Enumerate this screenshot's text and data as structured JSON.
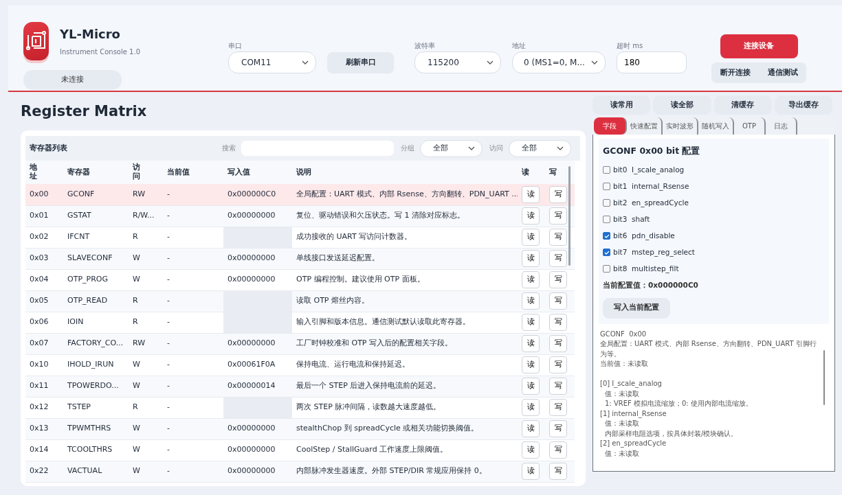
{
  "app": {
    "name": "YL-Micro",
    "subtitle": "Instrument Console 1.0",
    "status": "未连接"
  },
  "connection": {
    "port": {
      "label": "串口",
      "value": "COM11"
    },
    "refresh": "刷新串口",
    "baud": {
      "label": "波特率",
      "value": "115200"
    },
    "address": {
      "label": "地址",
      "value": "0 (MS1=0, M..."
    },
    "timeout": {
      "label": "超时 ms",
      "value": "180"
    },
    "connect": "连接设备",
    "disconnect": "断开连接",
    "test": "通信测试"
  },
  "title": "Register Matrix",
  "actions": [
    "读常用",
    "读全部",
    "清缓存",
    "导出缓存"
  ],
  "register_list": {
    "title": "寄存器列表",
    "search_label": "搜索",
    "group_label": "分组",
    "group_value": "全部",
    "access_label": "访问",
    "access_value": "全部",
    "columns": [
      "地址",
      "寄存器",
      "访问",
      "当前值",
      "写入值",
      "说明",
      "读",
      "写"
    ],
    "rows": [
      {
        "addr": "0x00",
        "name": "GCONF",
        "access": "RW",
        "current": "-",
        "write": "0x000000C0",
        "desc": "全局配置：UART 模式、内部 Rsense、方向翻转、PDN_UART ...",
        "read_button": "读",
        "write_button": "写",
        "selected": true
      },
      {
        "addr": "0x01",
        "name": "GSTAT",
        "access": "R/W...",
        "current": "-",
        "write": "0x00000000",
        "desc": "复位、驱动错误和欠压状态。写 1 清除对应标志。",
        "read_button": "读",
        "write_button": "写",
        "selected": false
      },
      {
        "addr": "0x02",
        "name": "IFCNT",
        "access": "R",
        "current": "-",
        "desc": "成功接收的 UART 写访问计数器。",
        "read_button": "读",
        "write_button": "写",
        "selected": false
      },
      {
        "addr": "0x03",
        "name": "SLAVECONF",
        "access": "W",
        "current": "-",
        "write": "0x00000000",
        "desc": "单线接口发送延迟配置。",
        "read_button": "读",
        "write_button": "写",
        "selected": false
      },
      {
        "addr": "0x04",
        "name": "OTP_PROG",
        "access": "W",
        "current": "-",
        "write": "0x00000000",
        "desc": "OTP 编程控制。建议使用 OTP 面板。",
        "read_button": "读",
        "write_button": "写",
        "selected": false
      },
      {
        "addr": "0x05",
        "name": "OTP_READ",
        "access": "R",
        "current": "-",
        "desc": "读取 OTP 熔丝内容。",
        "read_button": "读",
        "write_button": "写",
        "selected": false
      },
      {
        "addr": "0x06",
        "name": "IOIN",
        "access": "R",
        "current": "-",
        "desc": "输入引脚和版本信息。通信测试默认读取此寄存器。",
        "read_button": "读",
        "write_button": "写",
        "selected": false
      },
      {
        "addr": "0x07",
        "name": "FACTORY_CO...",
        "access": "RW",
        "current": "-",
        "write": "0x00000000",
        "desc": "工厂时钟校准和 OTP 写入后的配置相关字段。",
        "read_button": "读",
        "write_button": "写",
        "selected": false
      },
      {
        "addr": "0x10",
        "name": "IHOLD_IRUN",
        "access": "W",
        "current": "-",
        "write": "0x00061F0A",
        "desc": "保持电流、运行电流和保持延迟。",
        "read_button": "读",
        "write_button": "写",
        "selected": false
      },
      {
        "addr": "0x11",
        "name": "TPOWERDO...",
        "access": "W",
        "current": "-",
        "write": "0x00000014",
        "desc": "最后一个 STEP 后进入保持电流前的延迟。",
        "read_button": "读",
        "write_button": "写",
        "selected": false
      },
      {
        "addr": "0x12",
        "name": "TSTEP",
        "access": "R",
        "current": "-",
        "desc": "两次 STEP 脉冲间隔，读数越大速度越低。",
        "read_button": "读",
        "write_button": "写",
        "selected": false
      },
      {
        "addr": "0x13",
        "name": "TPWMTHRS",
        "access": "W",
        "current": "-",
        "write": "0x00000000",
        "desc": "stealthChop 到 spreadCycle 或相关功能切换阈值。",
        "read_button": "读",
        "write_button": "写",
        "selected": false
      },
      {
        "addr": "0x14",
        "name": "TCOOLTHRS",
        "access": "W",
        "current": "-",
        "write": "0x00000000",
        "desc": "CoolStep / StallGuard 工作速度上限阈值。",
        "read_button": "读",
        "write_button": "写",
        "selected": false
      },
      {
        "addr": "0x22",
        "name": "VACTUAL",
        "access": "W",
        "current": "-",
        "write": "0x00000000",
        "desc": "内部脉冲发生器速度。外部 STEP/DIR 常规应用保持 0。",
        "read_button": "读",
        "write_button": "写",
        "selected": false
      }
    ]
  },
  "tabs": [
    {
      "label": "字段",
      "selected": true
    },
    {
      "label": "快速配置",
      "selected": false
    },
    {
      "label": "实时波形",
      "selected": false
    },
    {
      "label": "随机写入",
      "selected": false
    },
    {
      "label": "OTP",
      "selected": false
    },
    {
      "label": "日志",
      "selected": false
    }
  ],
  "bit_config": {
    "title": "GCONF 0x00 bit 配置",
    "bits": [
      {
        "bit": "bit0",
        "name": "I_scale_analog",
        "checked": false
      },
      {
        "bit": "bit1",
        "name": "internal_Rsense",
        "checked": false
      },
      {
        "bit": "bit2",
        "name": "en_spreadCycle",
        "checked": false
      },
      {
        "bit": "bit3",
        "name": "shaft",
        "checked": false
      },
      {
        "bit": "bit6",
        "name": "pdn_disable",
        "checked": true
      },
      {
        "bit": "bit7",
        "name": "mstep_reg_select",
        "checked": true
      },
      {
        "bit": "bit8",
        "name": "multistep_filt",
        "checked": false
      }
    ],
    "current_value": "当前配置值：0x000000C0",
    "apply": "写入当前配置"
  },
  "details": {
    "header": [
      "GCONF  0x00",
      "全局配置：UART 模式、内部 Rsense、方向翻转、PDN_UART 引脚行为等。",
      "当前值：未读取"
    ],
    "fields": [
      {
        "title": "[0] I_scale_analog",
        "lines": [
          "值：未读取",
          "1: VREF 模拟电流缩放；0: 使用内部电流缩放。"
        ]
      },
      {
        "title": "[1] internal_Rsense",
        "lines": [
          "值：未读取",
          "内部采样电阻选项，按具体封装/模块确认。"
        ]
      },
      {
        "title": "[2] en_spreadCycle",
        "lines": [
          "值：未读取"
        ]
      }
    ]
  }
}
